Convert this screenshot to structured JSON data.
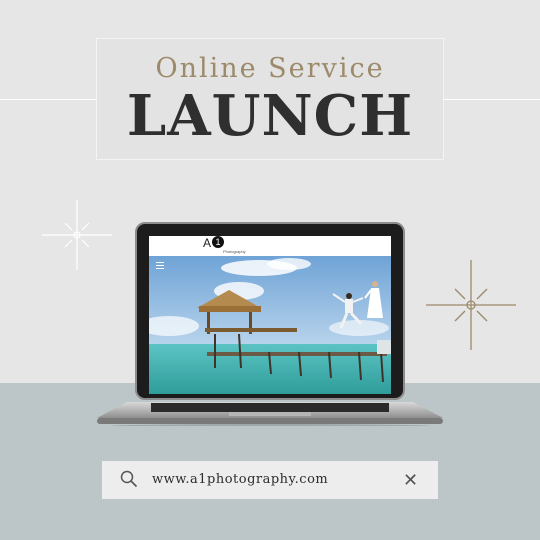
{
  "banner": {
    "subtitle": "Online Service",
    "title": "LAUNCH"
  },
  "website": {
    "logo_text": "A",
    "logo_badge": "1",
    "logo_subtitle": "Photography"
  },
  "search": {
    "url": "www.a1photography.com"
  },
  "colors": {
    "accent_gold": "#9c8a6a",
    "title_dark": "#2f2f2f",
    "background_top": "#e6e6e6",
    "background_bottom": "#bcc5c8"
  },
  "icons": {
    "search": "search-icon",
    "close": "close-icon",
    "sparkle": "sparkle-icon",
    "menu": "menu-icon"
  }
}
